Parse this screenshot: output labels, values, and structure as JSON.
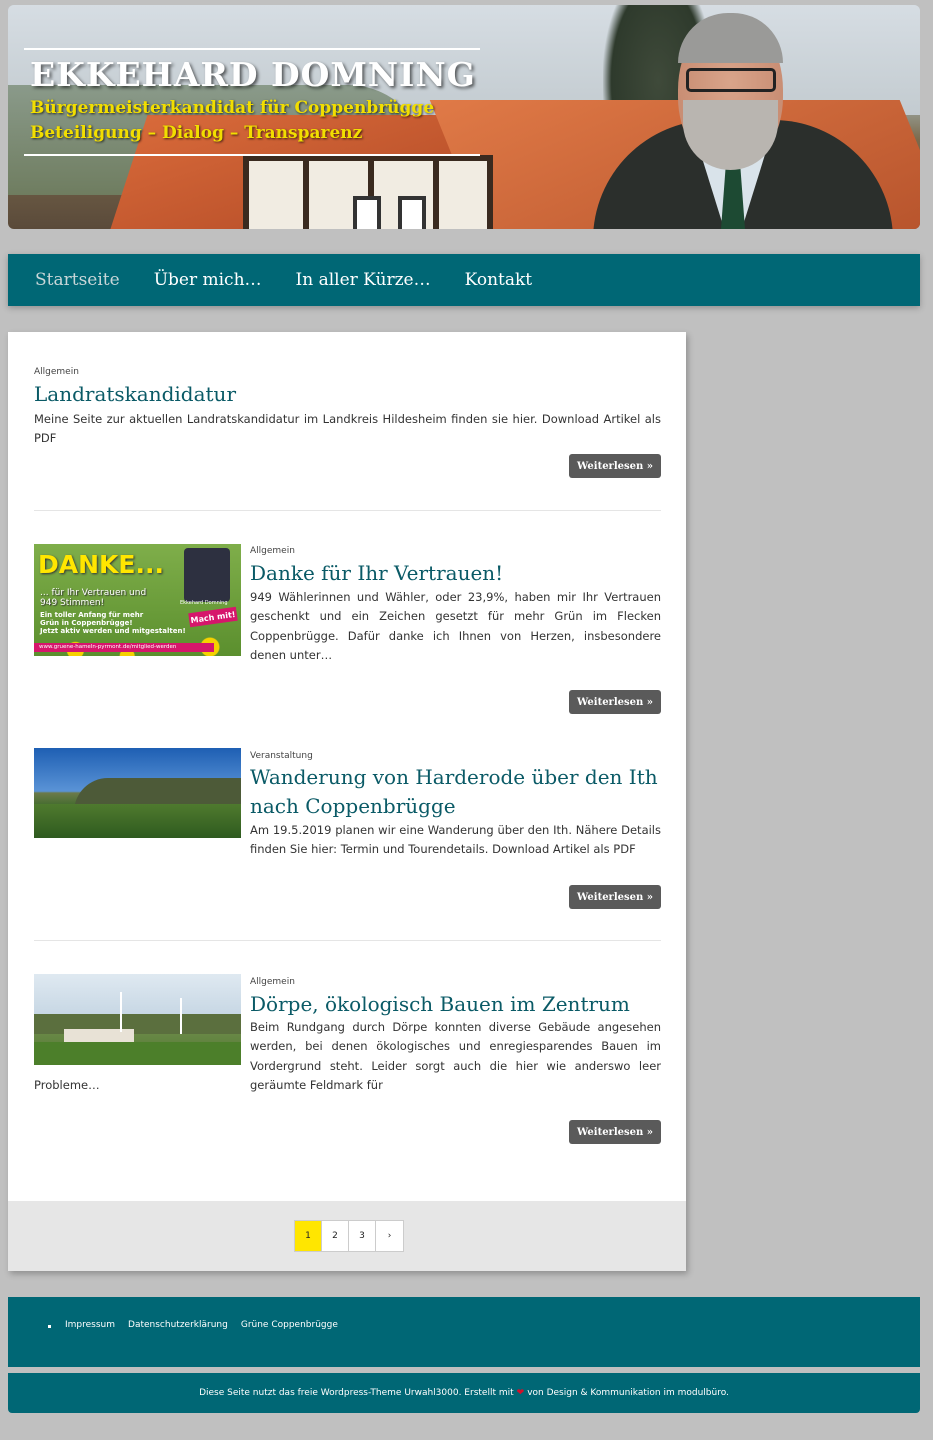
{
  "header": {
    "title": "EKKEHARD DOMNING",
    "subtitle1": "Bürgermeisterkandidat für Coppenbrügge",
    "subtitle2": "Beteiligung – Dialog – Transparenz"
  },
  "nav": {
    "items": [
      {
        "label": "Startseite",
        "active": true
      },
      {
        "label": "Über mich…",
        "active": false
      },
      {
        "label": "In aller Kürze…",
        "active": false
      },
      {
        "label": "Kontakt",
        "active": false
      }
    ]
  },
  "posts": [
    {
      "category": "Allgemein",
      "title": "Landratskandidatur",
      "excerpt": "Meine Seite zur aktuellen Landratskandidatur im Landkreis Hildesheim finden sie hier. Download Artikel als PDF",
      "button": "Weiterlesen »"
    },
    {
      "category": "Allgemein",
      "title": "Danke für Ihr Vertrauen!",
      "excerpt": "949 Wählerinnen und Wähler, oder 23,9%, haben mir Ihr Vertrauen geschenkt und ein Zeichen gesetzt für mehr Grün im Flecken Coppenbrügge. Dafür danke ich Ihnen von Herzen, insbesondere denen unter…",
      "button": "Weiterlesen »",
      "thumb": {
        "headline": "DANKE...",
        "line1": "... für Ihr Vertrauen und",
        "line2": "949 Stimmen!",
        "line3": "Ein toller Anfang für mehr",
        "line4": "Grün in Coppenbrügge!",
        "line5": "Jetzt aktiv werden und mitgestalten!",
        "badge": "Mach mit!",
        "url": "www.gruene-hameln-pyrmont.de/mitglied-werden",
        "name": "Ekkehard Domning"
      }
    },
    {
      "category": "Veranstaltung",
      "title": "Wanderung von Harderode über den Ith nach Coppenbrügge",
      "excerpt": "Am 19.5.2019 planen wir eine Wanderung über den Ith. Nähere Details finden Sie hier: Termin und Tourendetails. Download Artikel als PDF",
      "button": "Weiterlesen »"
    },
    {
      "category": "Allgemein",
      "title": "Dörpe, ökologisch Bauen im Zentrum",
      "excerpt_a": "Beim Rundgang durch Dörpe konnten diverse Gebäude angesehen werden, bei denen ökologisches und enregiesparendes Bauen im Vordergrund steht. Leider sorgt auch die hier wie anderswo leer geräumte Feldmark für",
      "excerpt_b": "Probleme…",
      "button": "Weiterlesen »"
    }
  ],
  "pagination": {
    "pages": [
      "1",
      "2",
      "3"
    ],
    "current": "1",
    "next": "›"
  },
  "footer": {
    "links": [
      "Impressum",
      "Datenschutzerklärung",
      "Grüne Coppenbrügge"
    ],
    "credit_before": "Diese Seite nutzt das freie Wordpress-Theme Urwahl3000. Erstellt mit",
    "credit_after": "von Design & Kommunikation im modulbüro.",
    "heart": "❤"
  },
  "colors": {
    "teal": "#006775",
    "title_teal": "#0a5a66",
    "subtitle_yellow": "#f2de00",
    "page_active": "#ffe600",
    "button_gray": "#5a5a5a"
  }
}
